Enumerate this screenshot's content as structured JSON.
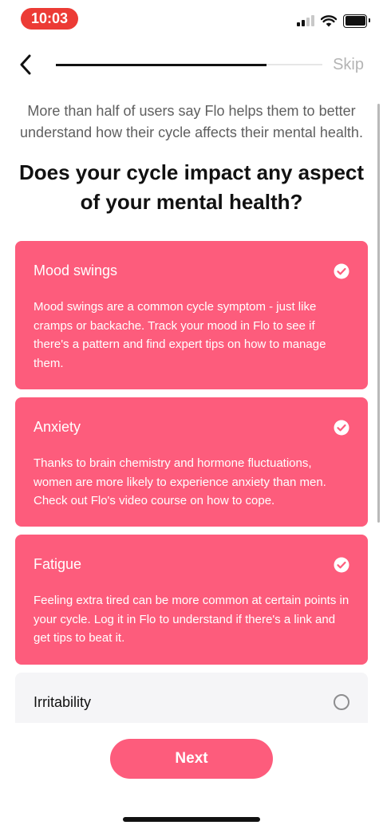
{
  "status_bar": {
    "time": "10:03",
    "time_pill_color": "#ec3b35"
  },
  "nav": {
    "skip_label": "Skip",
    "progress": 0.79
  },
  "subtitle": "More than half of users say Flo helps them to better understand how their cycle affects their mental health.",
  "question": "Does your cycle impact any aspect of your mental health?",
  "options": [
    {
      "title": "Mood swings",
      "description": "Mood swings are a common cycle symptom - just like cramps or backache. Track your mood in Flo to see if there's a pattern and find expert tips on how to manage them.",
      "selected": true
    },
    {
      "title": "Anxiety",
      "description": "Thanks to brain chemistry and hormone fluctuations, women are more likely to experience anxiety than men. Check out Flo's video course on how to cope.",
      "selected": true
    },
    {
      "title": "Fatigue",
      "description": "Feeling extra tired can be more common at certain points in your cycle. Log it in Flo to understand if there's a link and get tips to beat it.",
      "selected": true
    },
    {
      "title": "Irritability",
      "selected": false
    }
  ],
  "next_label": "Next",
  "colors": {
    "accent": "#fd5c7c",
    "unselected_card": "#f5f5f7",
    "skip_text": "#b4b4b4"
  },
  "icons": {
    "back": "chevron-left-icon",
    "selected": "check-circle-icon",
    "unselected": "radio-empty-icon"
  }
}
